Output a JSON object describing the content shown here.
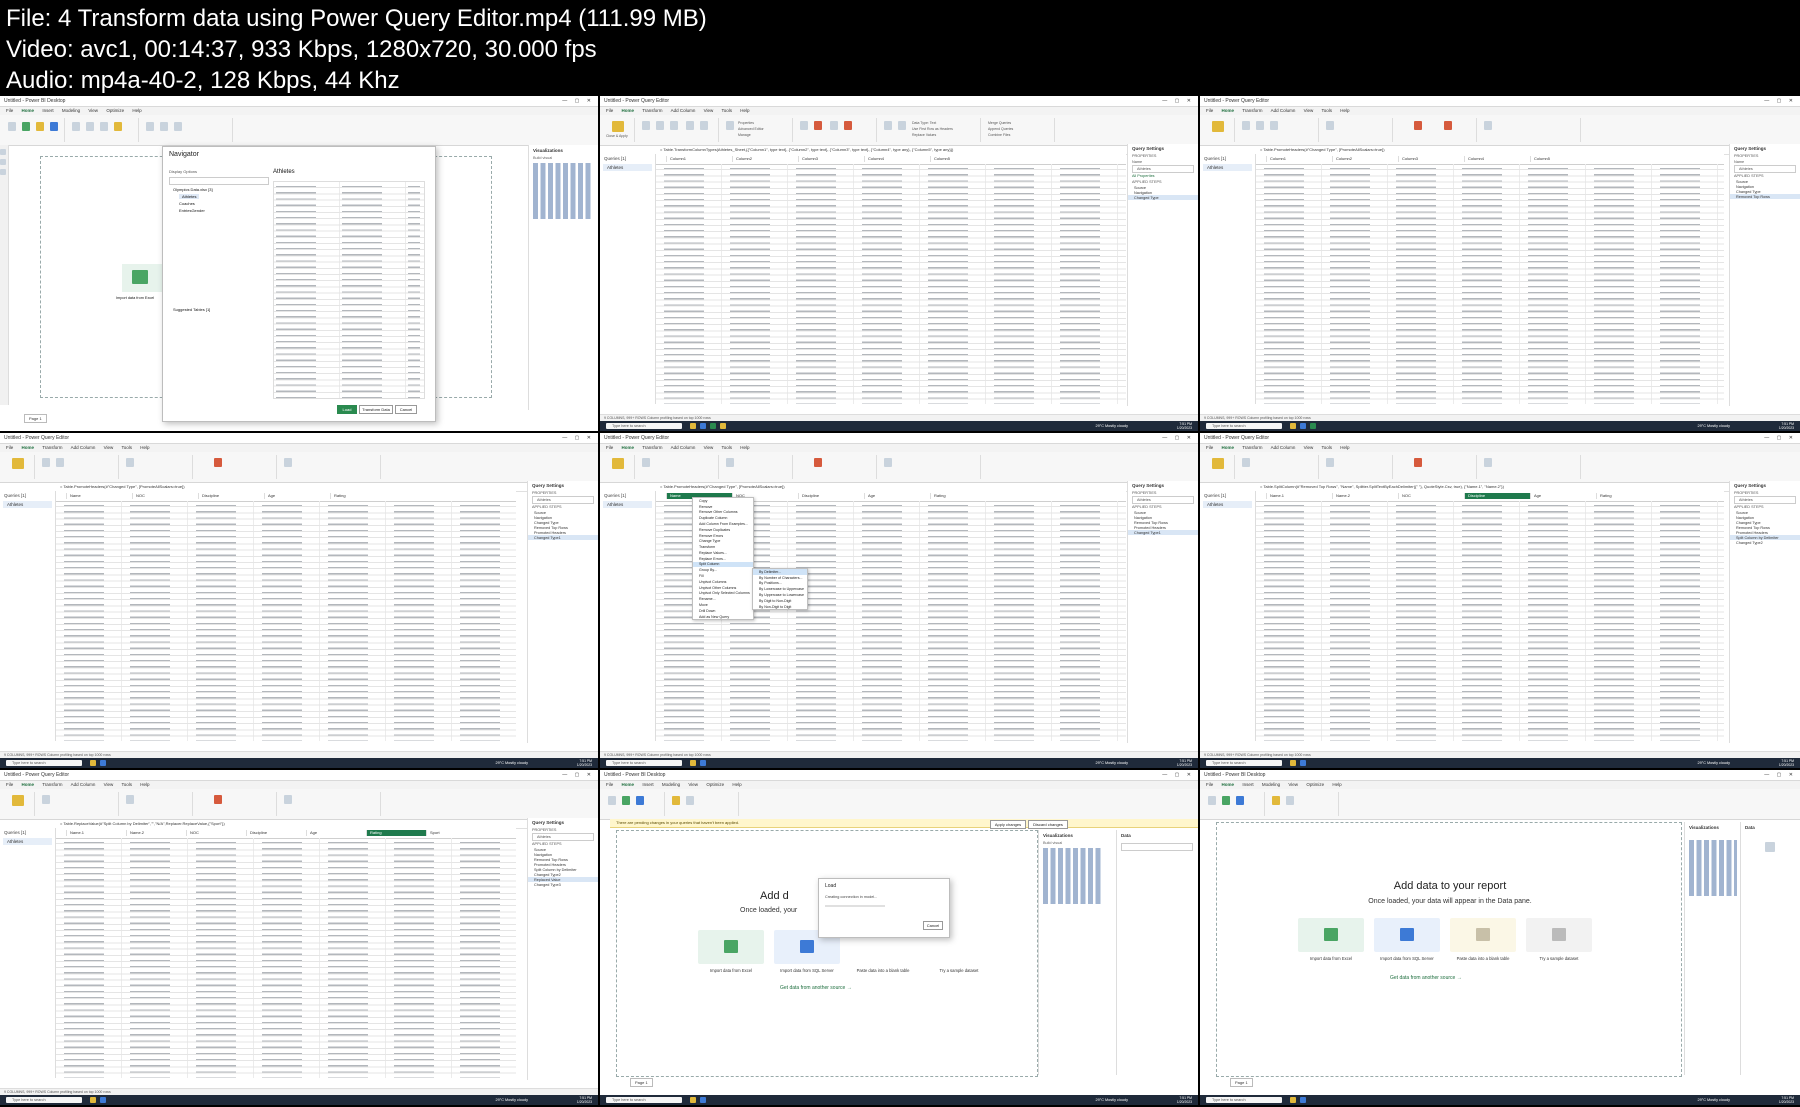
{
  "header": {
    "file_line": "File: 4  Transform data using Power Query Editor.mp4 (111.99 MB)",
    "video_line": "Video: avc1, 00:14:37, 933 Kbps, 1280x720, 30.000 fps",
    "audio_line": "Audio: mp4a-40-2, 128 Kbps, 44 Khz"
  },
  "common": {
    "pbi_title": "Untitled - Power BI Desktop",
    "pq_title": "Untitled - Power Query Editor",
    "pbi_menu": [
      "File",
      "Home",
      "Insert",
      "Modeling",
      "View",
      "Optimize",
      "Help"
    ],
    "pq_menu": [
      "File",
      "Home",
      "Transform",
      "Add Column",
      "View",
      "Tools",
      "Help"
    ],
    "ribbon_labels": [
      "Close & Apply",
      "New Source",
      "Recent Sources",
      "Enter Data",
      "Data source settings",
      "Manage Parameters",
      "Refresh Preview",
      "Properties",
      "Advanced Editor",
      "Manage",
      "Choose Columns",
      "Remove Columns",
      "Keep Rows",
      "Remove Rows",
      "Split Column",
      "Group By",
      "Data Type: Text",
      "Use First Row as Headers",
      "Replace Values",
      "Merge Queries",
      "Append Queries",
      "Combine Files"
    ],
    "taskbar_search": "Type here to search",
    "weather": "29°C Mostly cloudy",
    "clock_time": "7:51 PM",
    "clock_date": "1/20/2023",
    "queries_label": "Queries [1]",
    "query_name": "Athletes",
    "settings_title": "Query Settings",
    "properties": "PROPERTIES",
    "name_label": "Name",
    "all_properties": "All Properties",
    "applied_steps": "APPLIED STEPS",
    "status_text": "9 COLUMNS, 999+ ROWS   Column profiling based on top 1000 rows",
    "formula_1": "= Table.TransformColumnTypes(Athletes_Sheet,{{\"Column1\", type text}, {\"Column2\", type text}, {\"Column3\", type text}, {\"Column4\", type any}, {\"Column5\", type any}})",
    "formula_2": "= Table.PromoteHeaders(#\"Changed Type\", [PromoteAllScalars=true])",
    "formula_3": "= Table.SplitColumn(#\"Removed Top Rows\", \"Name\", Splitter.SplitTextByEachDelimiter({\" \"}, QuoteStyle.Csv, true), {\"Name.1\", \"Name.2\"})",
    "formula_4": "= Table.ReplaceValue(#\"Split Column by Delimiter\",\"\",\"N/A\",Replacer.ReplaceValue,{\"Sport\"})"
  },
  "columns_a": [
    "Column1",
    "Column2",
    "Column3",
    "Column4",
    "Column5"
  ],
  "columns_b": [
    "Name",
    "NOC",
    "Discipline",
    "Age",
    "Rating"
  ],
  "columns_c": [
    "Name.1",
    "Name.2",
    "NOC",
    "Discipline",
    "Age",
    "Rating",
    "Sport"
  ],
  "steps": {
    "s1": [
      "Source",
      "Navigation",
      "Changed Type"
    ],
    "s2": [
      "Source",
      "Navigation",
      "Changed Type",
      "Removed Top Rows"
    ],
    "s3": [
      "Source",
      "Navigation",
      "Changed Type",
      "Removed Top Rows",
      "Promoted Headers",
      "Changed Type1"
    ],
    "s4": [
      "Source",
      "Navigation",
      "Removed Top Rows",
      "Promoted Headers",
      "Changed Type1"
    ],
    "s5": [
      "Source",
      "Navigation",
      "Changed Type",
      "Removed Top Rows",
      "Promoted Headers",
      "Split Column by Delimiter",
      "Changed Type2"
    ],
    "s6": [
      "Source",
      "Navigation",
      "Removed Top Rows",
      "Promoted Headers",
      "Split Column by Delimiter",
      "Changed Type2",
      "Replaced Value",
      "Changed Type3"
    ]
  },
  "context_menu": [
    "Copy",
    "Remove",
    "Remove Other Columns",
    "Duplicate Column",
    "Add Column From Examples...",
    "Remove Duplicates",
    "Remove Errors",
    "Change Type",
    "Transform",
    "Replace Values...",
    "Replace Errors...",
    "Split Column",
    "Group By...",
    "Fill",
    "Unpivot Columns",
    "Unpivot Other Columns",
    "Unpivot Only Selected Columns",
    "Rename...",
    "Move",
    "Drill Down",
    "Add as New Query"
  ],
  "submenu": [
    "By Delimiter...",
    "By Number of Characters...",
    "By Positions...",
    "By Lowercase to Uppercase",
    "By Uppercase to Lowercase",
    "By Digit to Non-Digit",
    "By Non-Digit to Digit"
  ],
  "navigator": {
    "title": "Navigator",
    "display_options": "Display Options",
    "file": "Olympics Data.xlsx [3]",
    "items": [
      "Athletes",
      "Coaches",
      "EntriesGender"
    ],
    "preview_title": "Athletes",
    "suggested": "Suggested Tables [1]",
    "load": "Load",
    "transform": "Transform Data",
    "cancel": "Cancel"
  },
  "pbi": {
    "add_title": "Add data to your report",
    "add_sub": "Once loaded, your data will appear in the Data pane.",
    "add_title_partial": "Add d",
    "add_sub_partial": "Once loaded, your",
    "cards": [
      "Import data from Excel",
      "Import data from SQL Server",
      "Paste data into a blank table",
      "Try a sample dataset"
    ],
    "get_data": "Get data from another source →",
    "pending": "There are pending changes in your queries that haven't been applied.",
    "apply": "Apply changes",
    "discard": "Discard changes",
    "load_title": "Load",
    "load_sub": "Creating connection in model...",
    "load_cancel": "Cancel",
    "page_tab": "Page 1",
    "viz_title": "Visualizations",
    "data_title": "Data",
    "build_visual": "Build visual",
    "import_excel": "Import data from Excel"
  },
  "colors": {
    "pq_green": "#1f7a4d",
    "excel_green": "#2a8a4f",
    "sql_blue": "#3d7ad6",
    "taskbar": "#1f2a3a"
  }
}
